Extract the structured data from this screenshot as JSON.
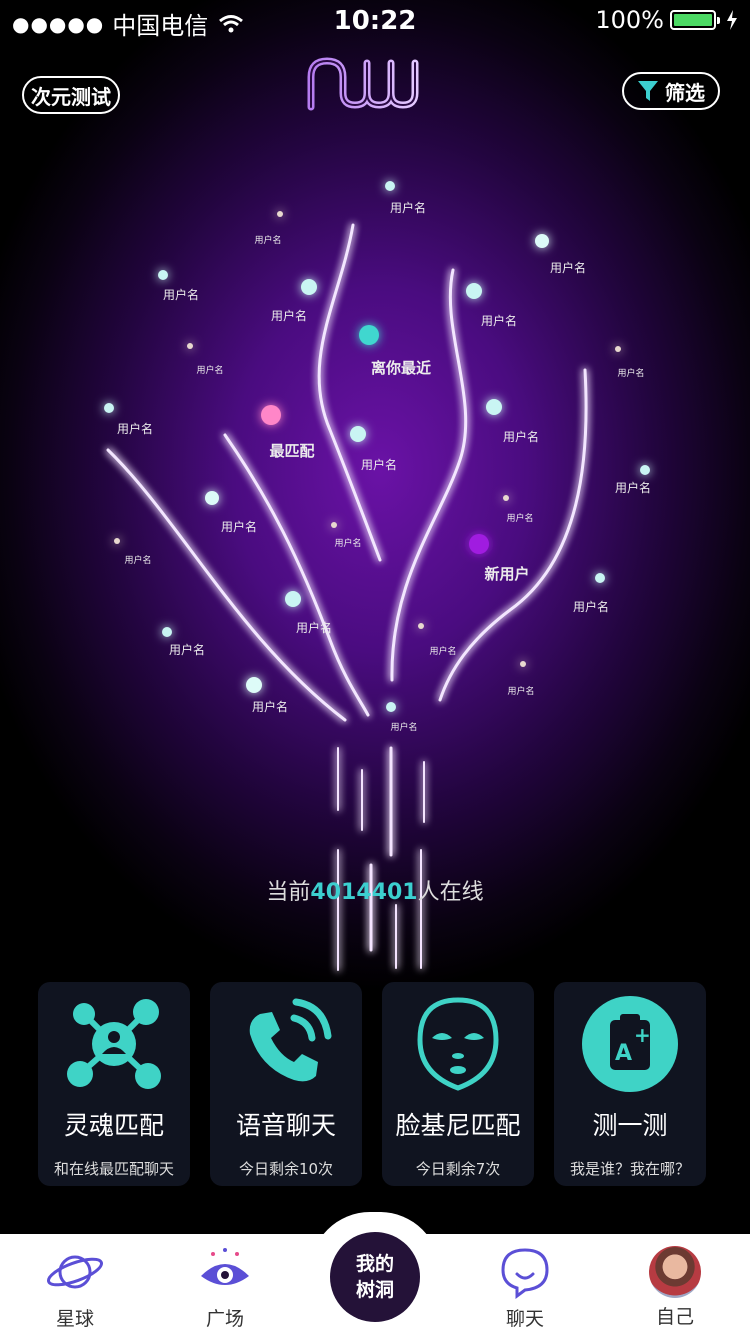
{
  "status_bar": {
    "signal": "●●●●●",
    "carrier": "中国电信",
    "time": "10:22",
    "battery_pct": "100%"
  },
  "header": {
    "left_button": "次元测试",
    "filter_button": "筛选"
  },
  "tree": {
    "featured": {
      "nearest": "离你最近",
      "best_match": "最匹配",
      "new_user": "新用户"
    },
    "placeholder_name": "用户名"
  },
  "online": {
    "prefix": "当前",
    "count": "4014401",
    "suffix": "人在线"
  },
  "cards": [
    {
      "title": "灵魂匹配",
      "sub": "和在线最匹配聊天",
      "icon": "network-user-icon"
    },
    {
      "title": "语音聊天",
      "sub": "今日剩余10次",
      "icon": "phone-call-icon"
    },
    {
      "title": "脸基尼匹配",
      "sub": "今日剩余7次",
      "icon": "mask-face-icon"
    },
    {
      "title": "测一测",
      "sub": "我是谁？我在哪？",
      "icon": "test-clipboard-icon"
    }
  ],
  "tabbar": {
    "tabs": [
      {
        "label": "星球",
        "icon": "planet-icon"
      },
      {
        "label": "广场",
        "icon": "eye-icon"
      },
      {
        "label": "聊天",
        "icon": "chat-bubble-icon"
      },
      {
        "label": "自己",
        "icon": "avatar"
      }
    ],
    "center_line1": "我的",
    "center_line2": "树洞"
  },
  "colors": {
    "accent_teal": "#3ccfcf",
    "card_bg": "#101420",
    "bg_purple": "#4a0c80"
  }
}
